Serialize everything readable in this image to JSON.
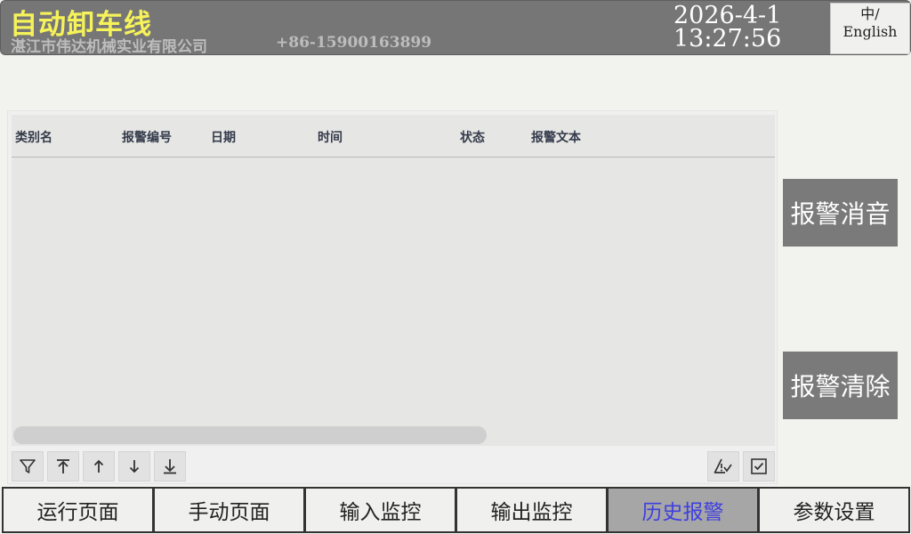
{
  "header": {
    "title": "自动卸车线",
    "company": "湛江市伟达机械实业有限公司",
    "phone": "+86-15900163899",
    "date": "2026-4-1",
    "time": "13:27:56",
    "language_button": {
      "line1": "中/",
      "line2": "English"
    }
  },
  "alarm_table": {
    "columns": [
      "类别名",
      "报警编号",
      "日期",
      "时间",
      "状态",
      "报警文本"
    ],
    "rows": []
  },
  "toolbar": {
    "left_icons": [
      "filter-icon",
      "scroll-top-icon",
      "arrow-up-icon",
      "arrow-down-icon",
      "scroll-bottom-icon"
    ],
    "right_icons": [
      "acknowledge-alarm-icon",
      "checkbox-icon"
    ]
  },
  "side_buttons": {
    "silence": "报警消音",
    "clear": "报警清除"
  },
  "nav": {
    "items": [
      "运行页面",
      "手动页面",
      "输入监控",
      "输出监控",
      "历史报警",
      "参数设置"
    ],
    "active_index": 4
  },
  "colors": {
    "header_bg": "#767676",
    "title": "#f5f25a",
    "active_nav_bg": "#a6a6a6",
    "active_nav_text": "#3f3fe0",
    "side_button_bg": "#7a7a7a"
  }
}
